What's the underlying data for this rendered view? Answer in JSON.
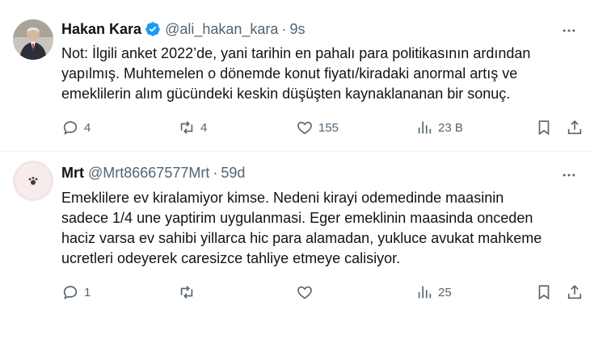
{
  "tweets": [
    {
      "name": "Hakan Kara",
      "handle": "@ali_hakan_kara",
      "separator": "·",
      "time": "9s",
      "verified": true,
      "lines": [
        "Not: İlgili anket 2022’de, yani tarihin en pahalı para politikasının ardından",
        "yapılmış. Muhtemelen o dönemde konut fiyatı/kiradaki anormal artış ve",
        "emeklilerin alım gücündeki keskin düşüşten kaynaklananan bir sonuç."
      ],
      "replies": "4",
      "retweets": "4",
      "likes": "155",
      "views": "23 B"
    },
    {
      "name": "Mrt",
      "handle": "@Mrt86667577Mrt",
      "separator": "·",
      "time": "59d",
      "verified": false,
      "lines": [
        "Emeklilere ev kiralamiyor kimse. Nedeni kirayi odemedinde maasinin",
        "sadece 1/4 une yaptirim uygulanmasi. Eger emeklinin maasinda onceden",
        "haciz varsa ev sahibi yillarca hic para alamadan, yukluce avukat mahkeme",
        "ucretleri odeyerek caresizce tahliye etmeye calisiyor."
      ],
      "replies": "1",
      "retweets": "",
      "likes": "",
      "views": "25"
    }
  ],
  "colors": {
    "text": "#0f1419",
    "muted": "#536471",
    "verified": "#1d9bf0",
    "divider": "#eff3f4"
  },
  "icons": [
    "reply-icon",
    "retweet-icon",
    "like-icon",
    "views-icon",
    "bookmark-icon",
    "share-icon",
    "more-icon",
    "verified-badge-icon"
  ]
}
